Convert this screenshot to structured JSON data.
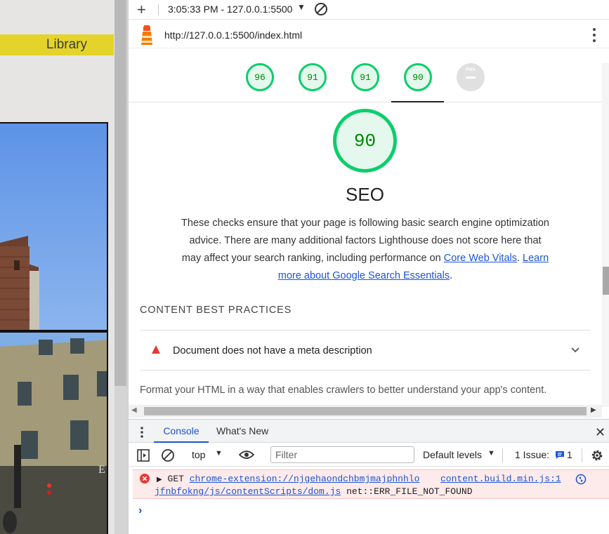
{
  "page": {
    "library_label": "Library"
  },
  "lighthouse": {
    "report_select": "3:05:33 PM - 127.0.0.1:5500",
    "url": "http://127.0.0.1:5500/index.html",
    "scores": [
      {
        "category": "performance",
        "value": "96"
      },
      {
        "category": "accessibility",
        "value": "91"
      },
      {
        "category": "best-practices",
        "value": "91"
      },
      {
        "category": "seo",
        "value": "90"
      }
    ],
    "pwa_label": "PWA",
    "active_score": "90",
    "category_title": "SEO",
    "description": "These checks ensure that your page is following basic search engine optimization advice. There are many additional factors Lighthouse does not score here that may affect your search ranking, including performance on",
    "link_core_web_vitals": "Core Web Vitals",
    "link_search_essentials": "Learn more about Google Search Essentials",
    "section_heading": "CONTENT BEST PRACTICES",
    "audit_title": "Document does not have a meta description",
    "section_footer": "Format your HTML in a way that enables crawlers to better understand your app's content.",
    "colors": {
      "pass": "#0cce6b",
      "pass_text": "#008800",
      "fail": "#e53935"
    }
  },
  "drawer": {
    "tabs": [
      "Console",
      "What's New"
    ],
    "active_tab": "Console"
  },
  "console": {
    "context": "top",
    "filter_placeholder": "Filter",
    "levels": "Default levels",
    "issues_label": "1 Issue:",
    "issues_count": "1",
    "error": {
      "method": "GET",
      "url_part1": "chrome-extension://njgehaondchbmjmajphnhlo",
      "url_part2": "jfnbfokng/js/contentScripts/dom.js",
      "source": "content.build.min.js:1",
      "message": "net::ERR_FILE_NOT_FOUND"
    },
    "prompt": "›"
  }
}
